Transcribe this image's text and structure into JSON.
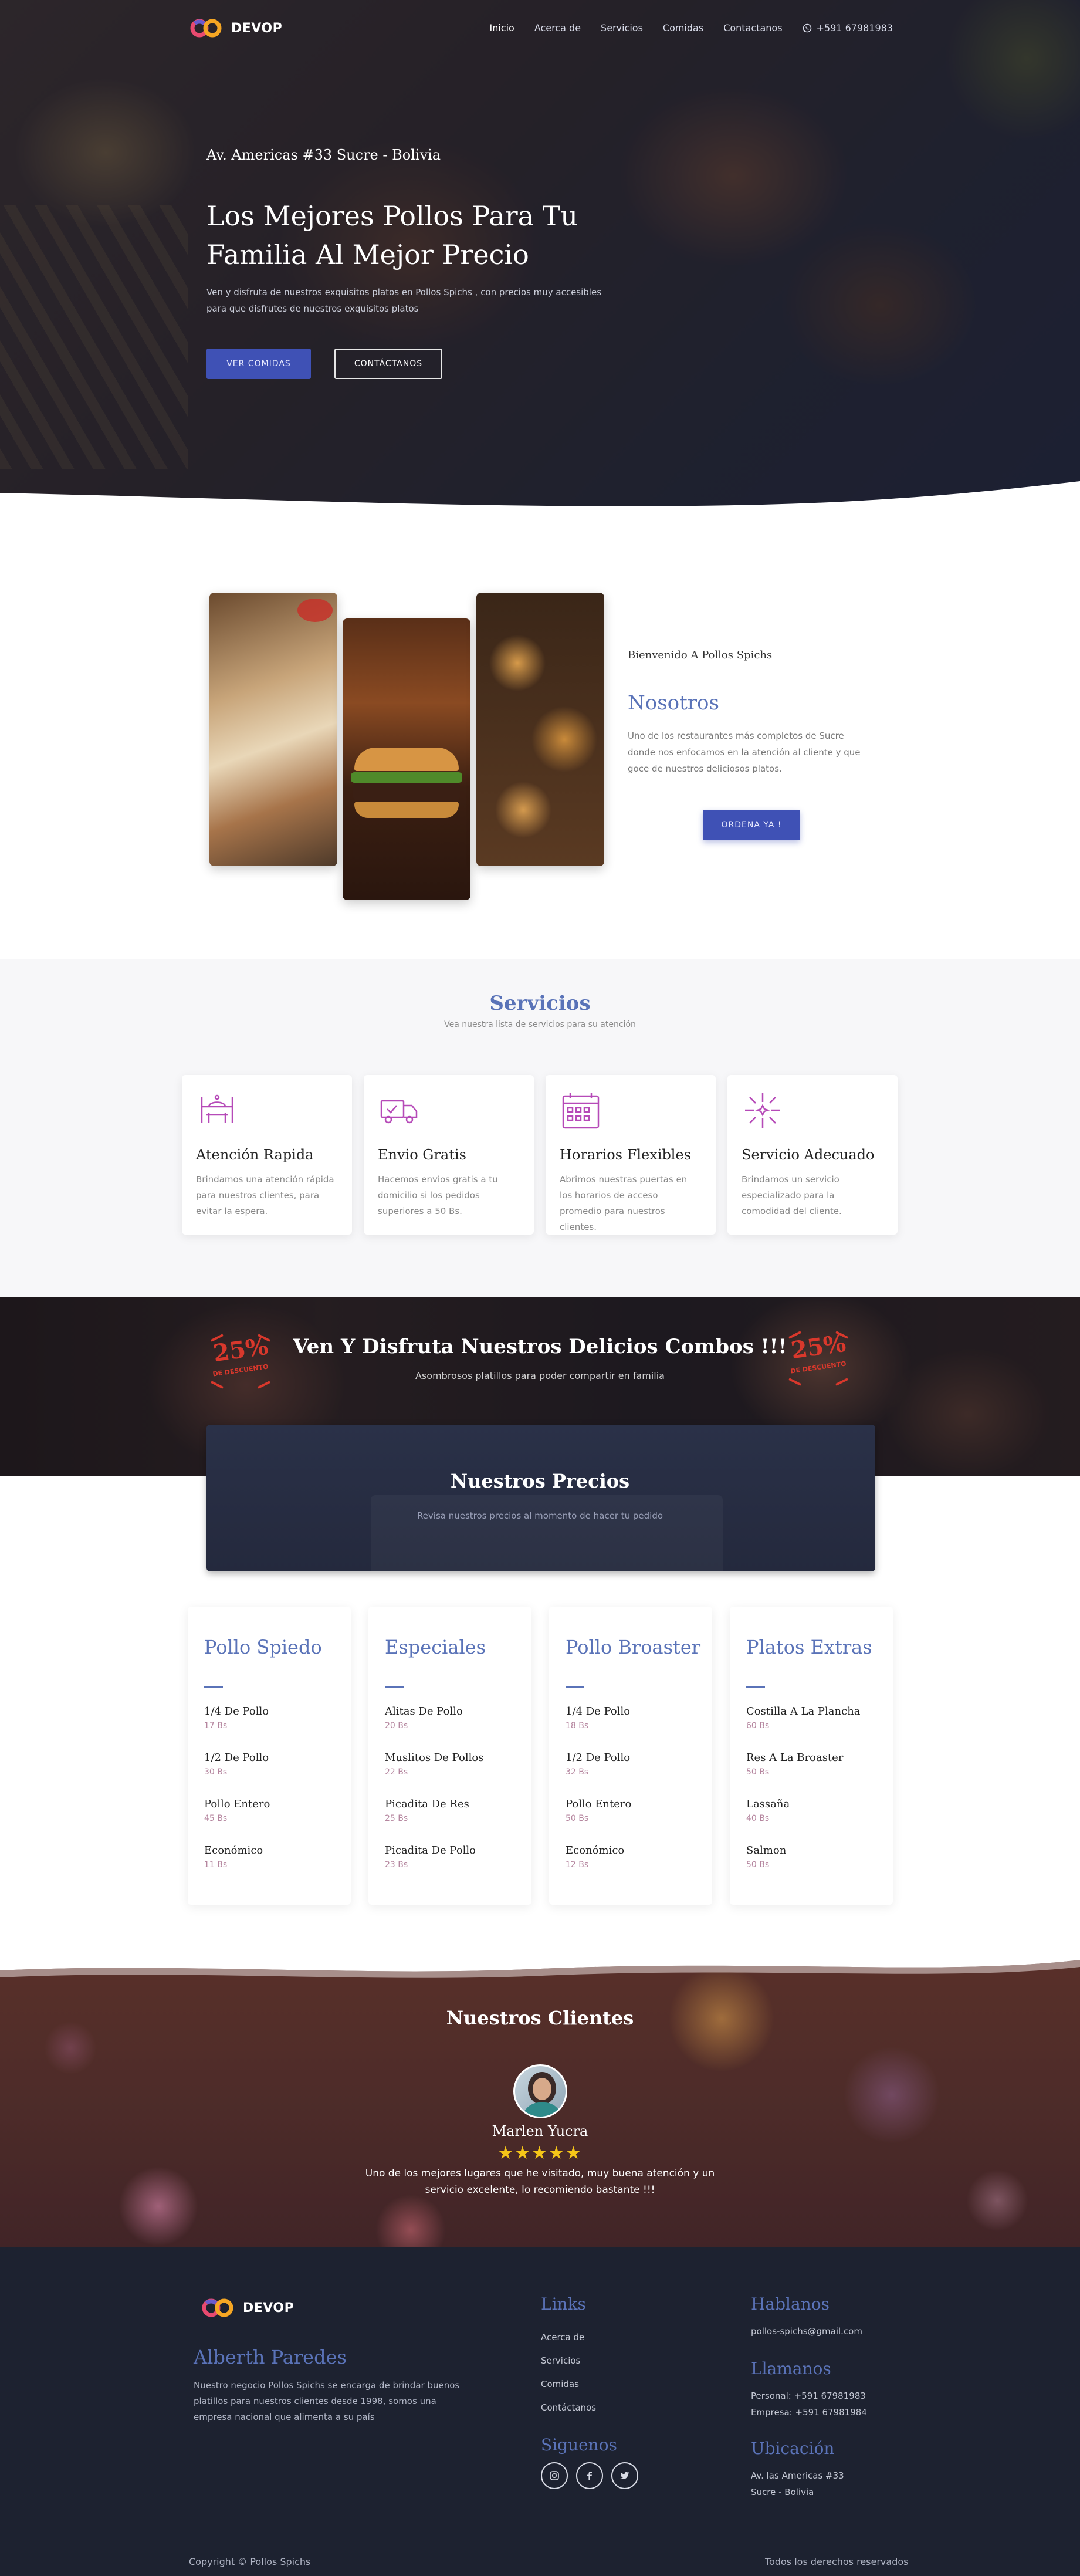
{
  "nav": {
    "brand": "DEVOP",
    "links": [
      "Inicio",
      "Acerca de",
      "Servicios",
      "Comidas",
      "Contactanos"
    ],
    "phone": "+591 67981983"
  },
  "hero": {
    "address": "Av. Americas #33 Sucre - Bolivia",
    "title": "Los Mejores Pollos Para Tu Familia Al Mejor Precio",
    "subtitle": "Ven y disfruta de nuestros exquisitos platos en Pollos Spichs , con precios muy accesibles para que disfrutes de nuestros exquisitos platos",
    "btn_primary": "VER COMIDAS",
    "btn_secondary": "CONTÁCTANOS"
  },
  "about": {
    "kicker": "Bienvenido A Pollos Spichs",
    "title": "Nosotros",
    "text": "Uno de los restaurantes más completos de Sucre donde nos enfocamos en la atención al cliente y que goce de nuestros deliciosos platos.",
    "button": "ORDENA YA !"
  },
  "services": {
    "title": "Servicios",
    "subtitle": "Vea nuestra lista de servicios para su atención",
    "items": [
      {
        "title": "Atención Rapida",
        "text": "Brindamos una atención rápida para nuestros clientes, para evitar la espera.",
        "icon": "waiter-icon"
      },
      {
        "title": "Envio Gratis",
        "text": "Hacemos envios gratis a tu domicilio si los pedidos superiores a 50 Bs.",
        "icon": "delivery-truck-icon"
      },
      {
        "title": "Horarios Flexibles",
        "text": "Abrimos nuestras puertas en los horarios de acceso promedio para nuestros clientes.",
        "icon": "calendar-icon"
      },
      {
        "title": "Servicio Adecuado",
        "text": "Brindamos un servicio especializado para la comodidad del cliente.",
        "icon": "sparkle-icon"
      }
    ]
  },
  "combos": {
    "title": "Ven Y Disfruta Nuestros Delicios Combos !!!",
    "subtitle": "Asombrosos platillos para poder compartir en familia",
    "promo_percent": "25%",
    "promo_label": "DE DESCUENTO"
  },
  "prices": {
    "title": "Nuestros Precios",
    "subtitle": "Revisa nuestros precios al momento de hacer tu pedido"
  },
  "menus": [
    {
      "title": "Pollo Spiedo",
      "items": [
        {
          "name": "1/4 De Pollo",
          "price": "17 Bs"
        },
        {
          "name": "1/2 De Pollo",
          "price": "30 Bs"
        },
        {
          "name": "Pollo Entero",
          "price": "45 Bs"
        },
        {
          "name": "Económico",
          "price": "11 Bs"
        }
      ]
    },
    {
      "title": "Especiales",
      "items": [
        {
          "name": "Alitas De Pollo",
          "price": "20 Bs"
        },
        {
          "name": "Muslitos De Pollos",
          "price": "22 Bs"
        },
        {
          "name": "Picadita De Res",
          "price": "25 Bs"
        },
        {
          "name": "Picadita De Pollo",
          "price": "23 Bs"
        }
      ]
    },
    {
      "title": "Pollo Broaster",
      "items": [
        {
          "name": "1/4 De Pollo",
          "price": "18 Bs"
        },
        {
          "name": "1/2 De Pollo",
          "price": "32 Bs"
        },
        {
          "name": "Pollo Entero",
          "price": "50 Bs"
        },
        {
          "name": "Económico",
          "price": "12 Bs"
        }
      ]
    },
    {
      "title": "Platos Extras",
      "items": [
        {
          "name": "Costilla A La Plancha",
          "price": "60 Bs"
        },
        {
          "name": "Res A La Broaster",
          "price": "50 Bs"
        },
        {
          "name": "Lassaña",
          "price": "40 Bs"
        },
        {
          "name": "Salmon",
          "price": "50 Bs"
        }
      ]
    }
  ],
  "testimonials": {
    "title": "Nuestros Clientes",
    "name": "Marlen Yucra",
    "stars": "★★★★★",
    "text": "Uno de los mejores lugares que he visitado, muy buena atención y un servicio excelente, lo recomiendo bastante !!!"
  },
  "footer": {
    "brand": "DEVOP",
    "owner": "Alberth Paredes",
    "about": "Nuestro negocio Pollos Spichs se encarga de brindar buenos platillos para nuestros clientes desde 1998, somos una empresa nacional que alimenta a su país",
    "links_title": "Links",
    "links": [
      "Acerca de",
      "Servicios",
      "Comidas",
      "Contáctanos"
    ],
    "social_title": "Siguenos",
    "talk_title": "Hablanos",
    "email": "pollos-spichs@gmail.com",
    "call_title": "Llamanos",
    "personal": "Personal: +591 67981983",
    "company": "Empresa: +591 67981984",
    "location_title": "Ubicación",
    "address_line1": "Av. las Americas #33",
    "address_line2": "Sucre - Bolivia",
    "copyright": "Copyright © Pollos Spichs",
    "rights": "Todos los derechos reservados"
  },
  "colors": {
    "accent": "#5a73b8",
    "primary_button": "#3f51b5",
    "footer_bg": "#1d2230",
    "price": "#b5869f",
    "icon": "#b64ab8"
  }
}
